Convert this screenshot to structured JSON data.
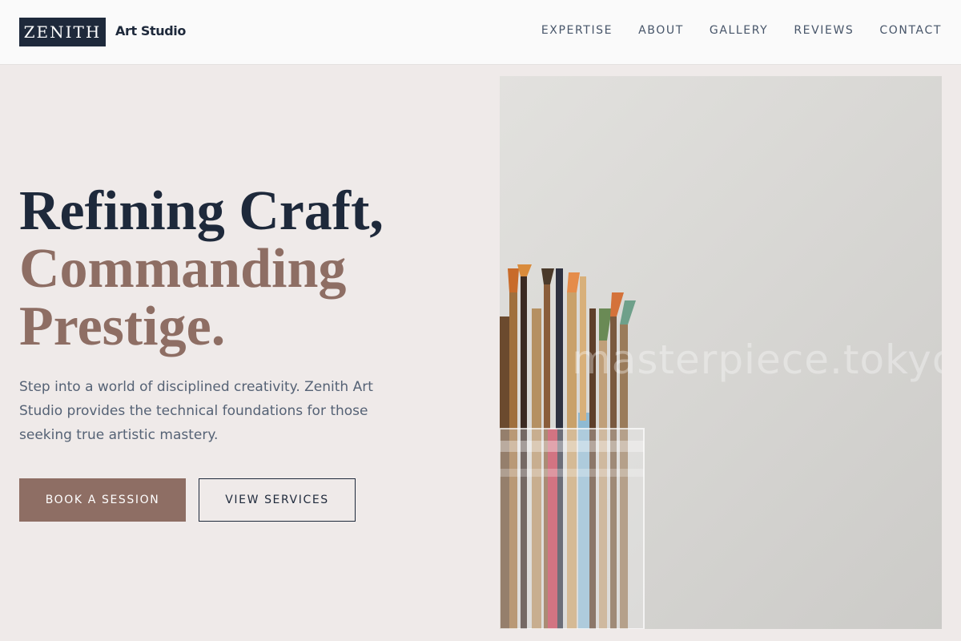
{
  "header": {
    "logo_text": "ZENITH",
    "logo_subtitle": "Art Studio",
    "nav": [
      "EXPERTISE",
      "ABOUT",
      "GALLERY",
      "REVIEWS",
      "CONTACT"
    ]
  },
  "hero": {
    "title_line1": "Refining Craft,",
    "title_line2": "Commanding",
    "title_line3": "Prestige.",
    "description": "Step into a world of disciplined creativity. Zenith Art Studio provides the technical foundations for those seeking true artistic mastery.",
    "primary_button": "BOOK A SESSION",
    "secondary_button": "VIEW SERVICES"
  },
  "image": {
    "watermark": "masterpiece.tokyo",
    "subject": "paint-brushes-in-glass-jar"
  },
  "colors": {
    "navy": "#1e293b",
    "mauve": "#8e6e64",
    "background": "#efeae9"
  }
}
